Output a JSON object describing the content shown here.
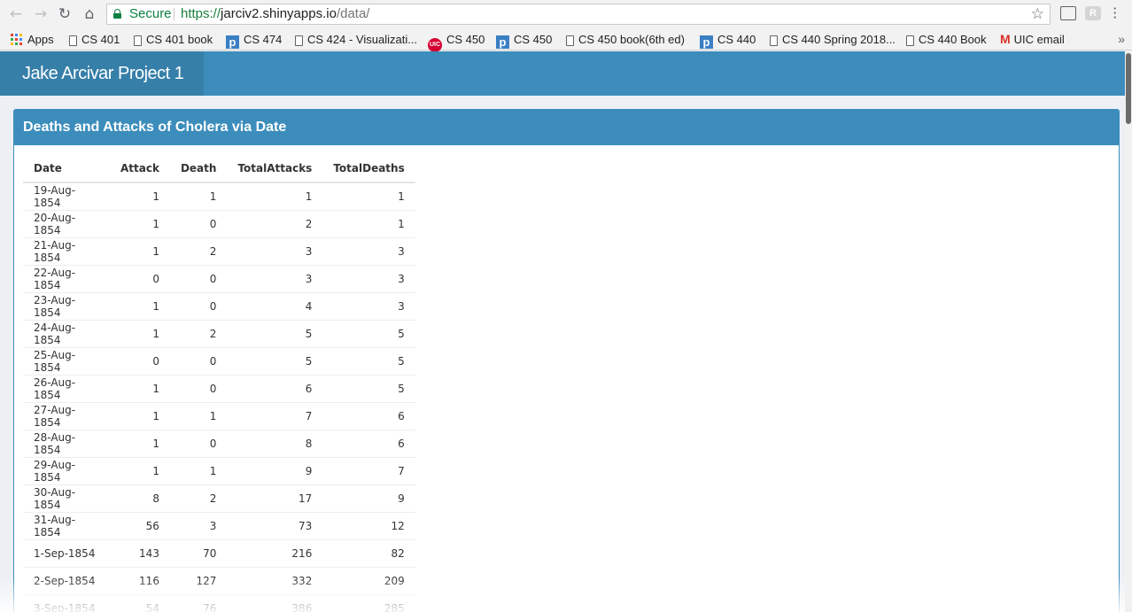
{
  "browser": {
    "secure_label": "Secure",
    "url_scheme": "https://",
    "url_host": "jarciv2.shinyapps.io",
    "url_path": "/data/",
    "bookmarks": [
      {
        "label": "Apps",
        "icon": "apps-icon"
      },
      {
        "label": "CS 401",
        "icon": "doc-icon"
      },
      {
        "label": "CS 401 book",
        "icon": "doc-icon"
      },
      {
        "label": "CS 474",
        "icon": "p-icon"
      },
      {
        "label": "CS 424 - Visualizati...",
        "icon": "doc-icon"
      },
      {
        "label": "CS 450",
        "icon": "uic-icon"
      },
      {
        "label": "CS 450",
        "icon": "p-icon"
      },
      {
        "label": "CS 450 book(6th ed)",
        "icon": "doc-icon"
      },
      {
        "label": "CS 440",
        "icon": "p-icon"
      },
      {
        "label": "CS 440 Spring 2018...",
        "icon": "doc-icon"
      },
      {
        "label": "CS 440 Book",
        "icon": "doc-icon"
      },
      {
        "label": "UIC email",
        "icon": "gmail-icon"
      }
    ],
    "uic_icon_text": "UIC",
    "p_icon_text": "p",
    "ext_icon_text": "R"
  },
  "header": {
    "title": "Jake Arcivar Project 1",
    "color": "#3c8dbc",
    "brand_color": "#367fa9"
  },
  "box": {
    "title": "Deaths and Attacks of Cholera via Date"
  },
  "table": {
    "columns": [
      "Date",
      "Attack",
      "Death",
      "TotalAttacks",
      "TotalDeaths"
    ],
    "rows": [
      [
        "19-Aug-1854",
        "1",
        "1",
        "1",
        "1"
      ],
      [
        "20-Aug-1854",
        "1",
        "0",
        "2",
        "1"
      ],
      [
        "21-Aug-1854",
        "1",
        "2",
        "3",
        "3"
      ],
      [
        "22-Aug-1854",
        "0",
        "0",
        "3",
        "3"
      ],
      [
        "23-Aug-1854",
        "1",
        "0",
        "4",
        "3"
      ],
      [
        "24-Aug-1854",
        "1",
        "2",
        "5",
        "5"
      ],
      [
        "25-Aug-1854",
        "0",
        "0",
        "5",
        "5"
      ],
      [
        "26-Aug-1854",
        "1",
        "0",
        "6",
        "5"
      ],
      [
        "27-Aug-1854",
        "1",
        "1",
        "7",
        "6"
      ],
      [
        "28-Aug-1854",
        "1",
        "0",
        "8",
        "6"
      ],
      [
        "29-Aug-1854",
        "1",
        "1",
        "9",
        "7"
      ],
      [
        "30-Aug-1854",
        "8",
        "2",
        "17",
        "9"
      ],
      [
        "31-Aug-1854",
        "56",
        "3",
        "73",
        "12"
      ],
      [
        "1-Sep-1854",
        "143",
        "70",
        "216",
        "82"
      ],
      [
        "2-Sep-1854",
        "116",
        "127",
        "332",
        "209"
      ],
      [
        "3-Sep-1854",
        "54",
        "76",
        "386",
        "285"
      ]
    ]
  }
}
